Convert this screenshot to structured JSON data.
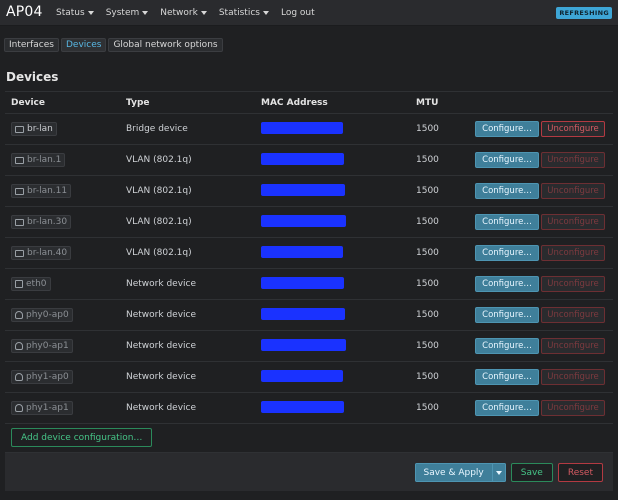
{
  "header": {
    "brand": "AP04",
    "menu": [
      "Status",
      "System",
      "Network",
      "Statistics",
      "Log out"
    ],
    "status_badge": "REFRESHING"
  },
  "tabs": [
    {
      "label": "Interfaces",
      "active": false
    },
    {
      "label": "Devices",
      "active": true
    },
    {
      "label": "Global network options",
      "active": false
    }
  ],
  "page": {
    "title": "Devices"
  },
  "table": {
    "columns": [
      "Device",
      "Type",
      "MAC Address",
      "MTU"
    ],
    "rows": [
      {
        "device": "br-lan",
        "type": "Bridge device",
        "mtu": "1500",
        "icon": "bridge-icon",
        "unconfigure_enabled": true
      },
      {
        "device": "br-lan.1",
        "type": "VLAN (802.1q)",
        "mtu": "1500",
        "icon": "vlan-icon",
        "unconfigure_enabled": false
      },
      {
        "device": "br-lan.11",
        "type": "VLAN (802.1q)",
        "mtu": "1500",
        "icon": "vlan-icon",
        "unconfigure_enabled": false
      },
      {
        "device": "br-lan.30",
        "type": "VLAN (802.1q)",
        "mtu": "1500",
        "icon": "vlan-icon",
        "unconfigure_enabled": false
      },
      {
        "device": "br-lan.40",
        "type": "VLAN (802.1q)",
        "mtu": "1500",
        "icon": "vlan-icon",
        "unconfigure_enabled": false
      },
      {
        "device": "eth0",
        "type": "Network device",
        "mtu": "1500",
        "icon": "ethernet-port-icon",
        "unconfigure_enabled": false
      },
      {
        "device": "phy0-ap0",
        "type": "Network device",
        "mtu": "1500",
        "icon": "wifi-icon",
        "unconfigure_enabled": false
      },
      {
        "device": "phy0-ap1",
        "type": "Network device",
        "mtu": "1500",
        "icon": "wifi-icon",
        "unconfigure_enabled": false
      },
      {
        "device": "phy1-ap0",
        "type": "Network device",
        "mtu": "1500",
        "icon": "wifi-icon",
        "unconfigure_enabled": false
      },
      {
        "device": "phy1-ap1",
        "type": "Network device",
        "mtu": "1500",
        "icon": "wifi-icon",
        "unconfigure_enabled": false
      }
    ],
    "configure_label": "Configure…",
    "unconfigure_label": "Unconfigure"
  },
  "actions": {
    "add_device": "Add device configuration…",
    "save_apply": "Save & Apply",
    "save": "Save",
    "reset": "Reset"
  },
  "colors": {
    "accent": "#3f7f9a",
    "danger": "#b33a42",
    "success": "#2b8a5b",
    "redacted": "#1a32ff"
  }
}
